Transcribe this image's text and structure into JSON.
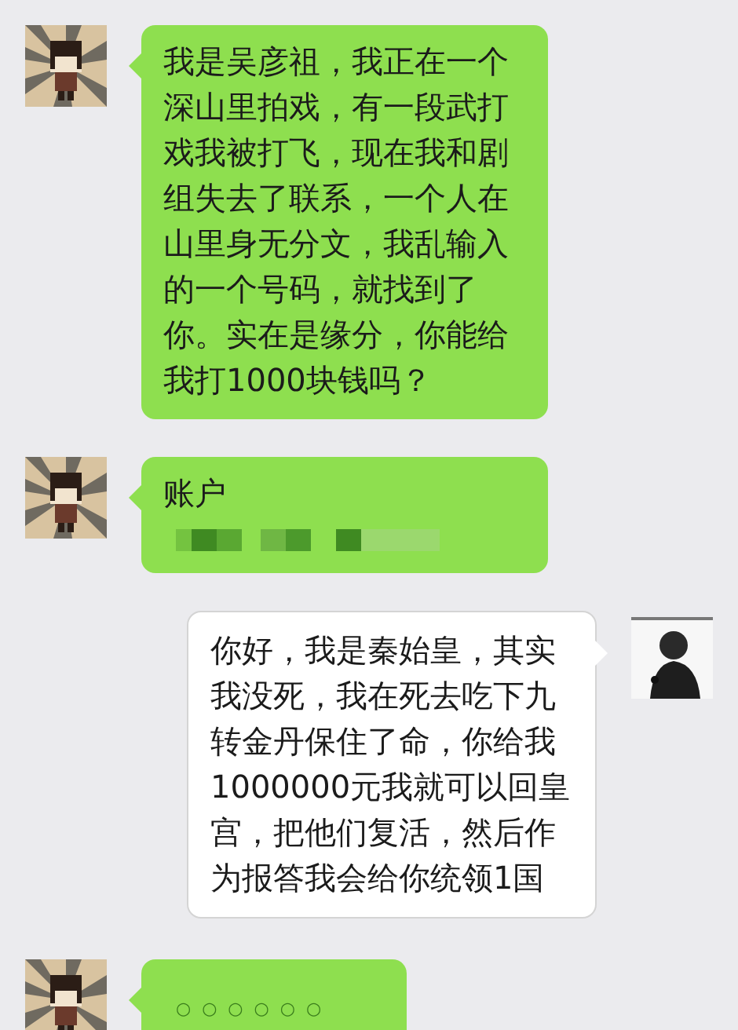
{
  "messages": [
    {
      "kind": "received",
      "text": "我是吴彦祖，我正在一个深山里拍戏，有一段武打戏我被打飞，现在我和剧组失去了联系，一个人在山里身无分文，我乱输入的一个号码，就找到了你。实在是缘分，你能给我打1000块钱吗？",
      "redacted": false
    },
    {
      "kind": "received",
      "text": "账户",
      "redacted": true
    },
    {
      "kind": "sent",
      "text": "你好，我是秦始皇，其实我没死，我在死去吃下九转金丹保住了命，你给我1000000元我就可以回皇宫，把他们复活，然后作为报答我会给你统领1国",
      "redacted": false
    },
    {
      "kind": "received",
      "text": "○  ○  ○  ○  ○  ○",
      "redacted": false
    }
  ]
}
